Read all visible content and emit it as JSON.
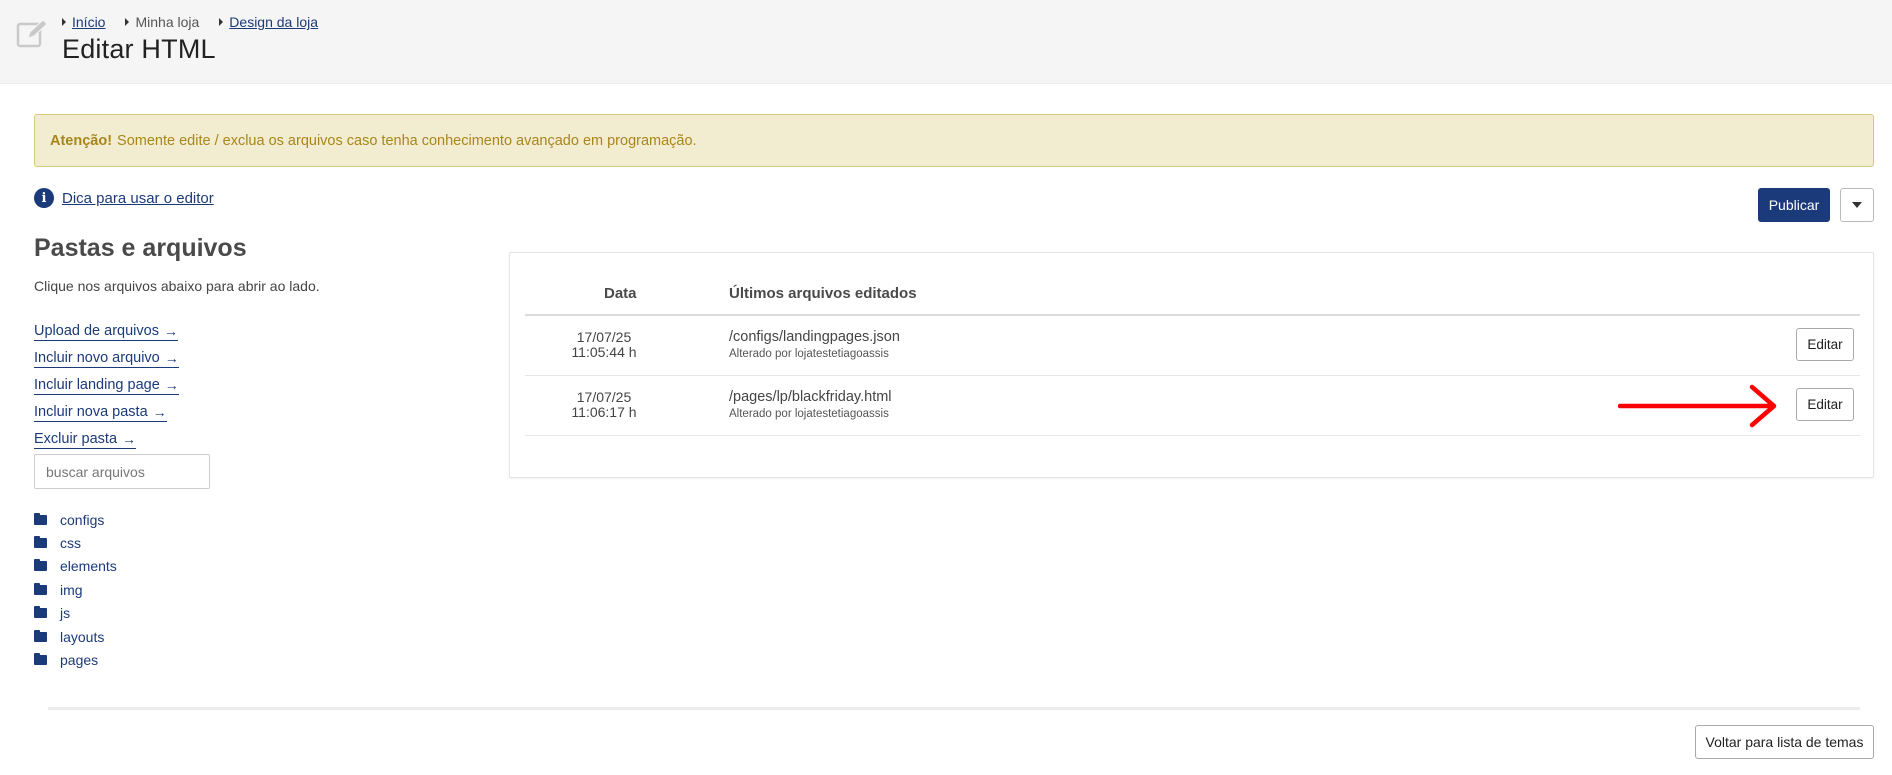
{
  "header": {
    "breadcrumb": [
      {
        "label": "Início",
        "link": true
      },
      {
        "label": "Minha loja",
        "link": false
      },
      {
        "label": "Design da loja",
        "link": true
      }
    ],
    "title": "Editar HTML",
    "icon": "edit-icon"
  },
  "alert": {
    "strong": "Atenção!",
    "text": "Somente edite / exclua os arquivos caso tenha conhecimento avançado em programação.",
    "color": "#a7861b",
    "background": "#f2ecd1"
  },
  "tip": {
    "icon": "info-icon",
    "label": "Dica para usar o editor"
  },
  "publish": {
    "label": "Publicar",
    "caret_icon": "caret-down-icon",
    "color": "#1b3a7a"
  },
  "sidebar": {
    "title": "Pastas e arquivos",
    "subtitle": "Clique nos arquivos abaixo para abrir ao lado.",
    "actions": [
      {
        "label": "Upload de arquivos",
        "arrow": "→"
      },
      {
        "label": "Incluir novo arquivo",
        "arrow": "→"
      },
      {
        "label": "Incluir landing page",
        "arrow": "→"
      },
      {
        "label": "Incluir nova pasta",
        "arrow": "→"
      },
      {
        "label": "Excluir pasta",
        "arrow": "→"
      }
    ],
    "search": {
      "placeholder": "buscar arquivos",
      "value": ""
    },
    "folders": [
      "configs",
      "css",
      "elements",
      "img",
      "js",
      "layouts",
      "pages"
    ]
  },
  "recent": {
    "headers": {
      "date": "Data",
      "files": "Últimos arquivos editados"
    },
    "rows": [
      {
        "date": "17/07/25",
        "time": "11:05:44 h",
        "path": "/configs/landingpages.json",
        "by": "Alterado por lojatestetiagoassis",
        "action": "Editar"
      },
      {
        "date": "17/07/25",
        "time": "11:06:17 h",
        "path": "/pages/lp/blackfriday.html",
        "by": "Alterado por lojatestetiagoassis",
        "action": "Editar"
      }
    ]
  },
  "annotation": {
    "color": "#ff0000"
  },
  "footer": {
    "back_label": "Voltar para lista de temas"
  }
}
